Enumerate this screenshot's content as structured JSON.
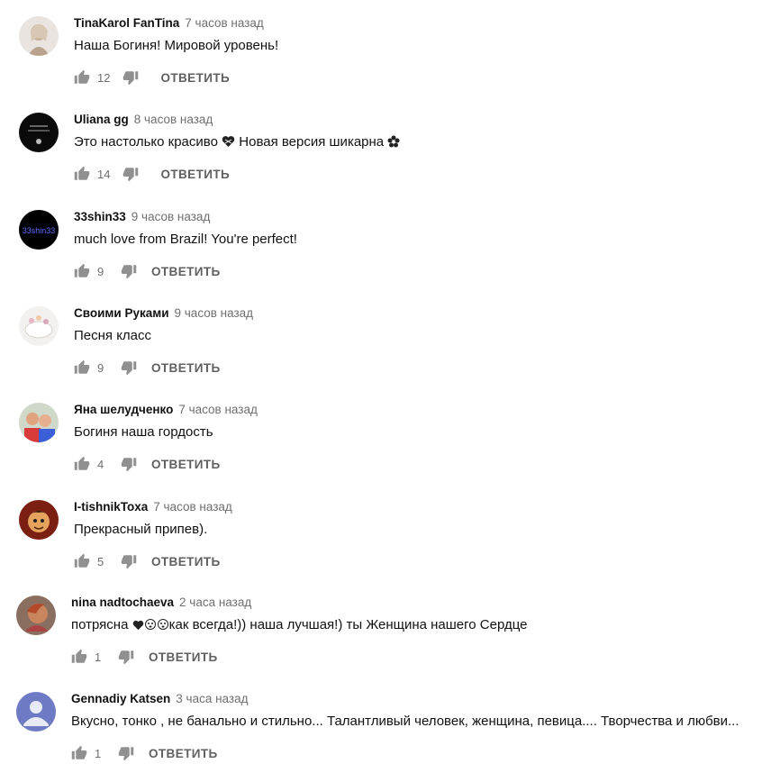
{
  "comments": [
    {
      "author": "TinaKarol FanTina",
      "time": "7 часов назад",
      "text": "Наша  Богиня! Мировой уровень!",
      "likes": "12",
      "reply": "ОТВЕТИТЬ"
    },
    {
      "author": "Uliana gg",
      "time": "8 часов назад",
      "text_before": "Это настолько красиво",
      "text_mid": "Новая версия шикарна",
      "likes": "14",
      "reply": "ОТВЕТИТЬ"
    },
    {
      "author": "33shin33",
      "time": "9 часов назад",
      "text": "much love from Brazil! You're perfect!",
      "likes": "9",
      "reply": "ОТВЕТИТЬ",
      "avatar_text": "33shin33"
    },
    {
      "author": "Своими Руками",
      "time": "9 часов назад",
      "text": "Песня класс",
      "likes": "9",
      "reply": "ОТВЕТИТЬ"
    },
    {
      "author": "Яна шелудченко",
      "time": "7 часов назад",
      "text": "Богиня наша гордость",
      "likes": "4",
      "reply": "ОТВЕТИТЬ"
    },
    {
      "author": "I-tishnikToxa",
      "time": "7 часов назад",
      "text": "Прекрасный припев).",
      "likes": "5",
      "reply": "ОТВЕТИТЬ"
    },
    {
      "author": "nina nadtochaeva",
      "time": "2 часа назад",
      "text_before": "потрясна ",
      "text_after": "как всегда!))  наша лучшая!)  ты Женщина нашего Сердце",
      "likes": "1",
      "reply": "ОТВЕТИТЬ"
    },
    {
      "author": "Gennadiy Katsen",
      "time": "3 часа назад",
      "text": "Вкусно, тонко , не банально и стильно... Талантливый человек, женщина, певица.... Творчества и любви...",
      "likes": "1",
      "reply": "ОТВЕТИТЬ"
    }
  ],
  "icons": {
    "like": "thumb-up-icon",
    "dislike": "thumb-down-icon"
  },
  "colors": {
    "icon": "#909090",
    "meta": "#6f6f6f",
    "reply": "#606060",
    "default_avatar": "#6e7bc4"
  }
}
